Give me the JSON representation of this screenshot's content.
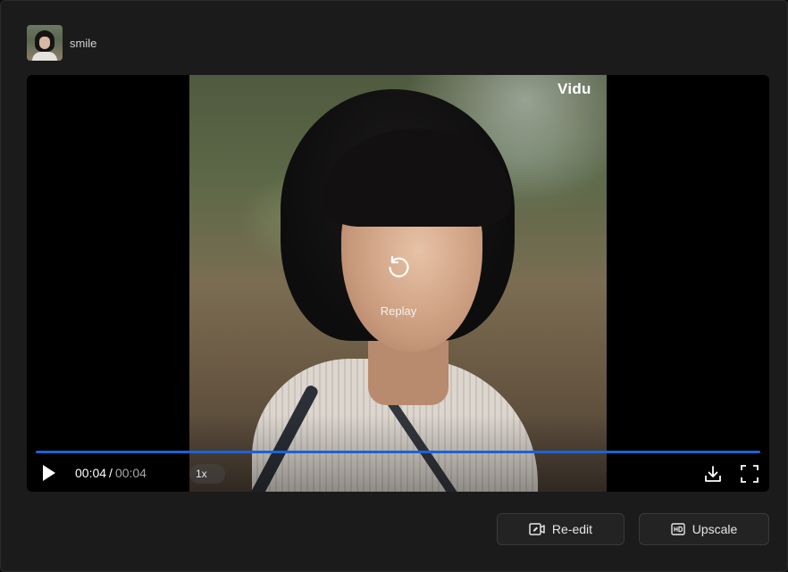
{
  "header": {
    "title": "smile"
  },
  "player": {
    "watermark": "Vidu",
    "replay_label": "Replay",
    "current_time": "00:04",
    "separator": "/",
    "duration": "00:04",
    "speed": "1x",
    "progress_fraction": 1.0,
    "accent_color": "#1c62d8"
  },
  "actions": {
    "reedit_label": "Re-edit",
    "upscale_label": "Upscale"
  },
  "icons": [
    "replay-icon",
    "play-icon",
    "download-icon",
    "fullscreen-icon",
    "video-edit-icon",
    "hd-icon"
  ]
}
